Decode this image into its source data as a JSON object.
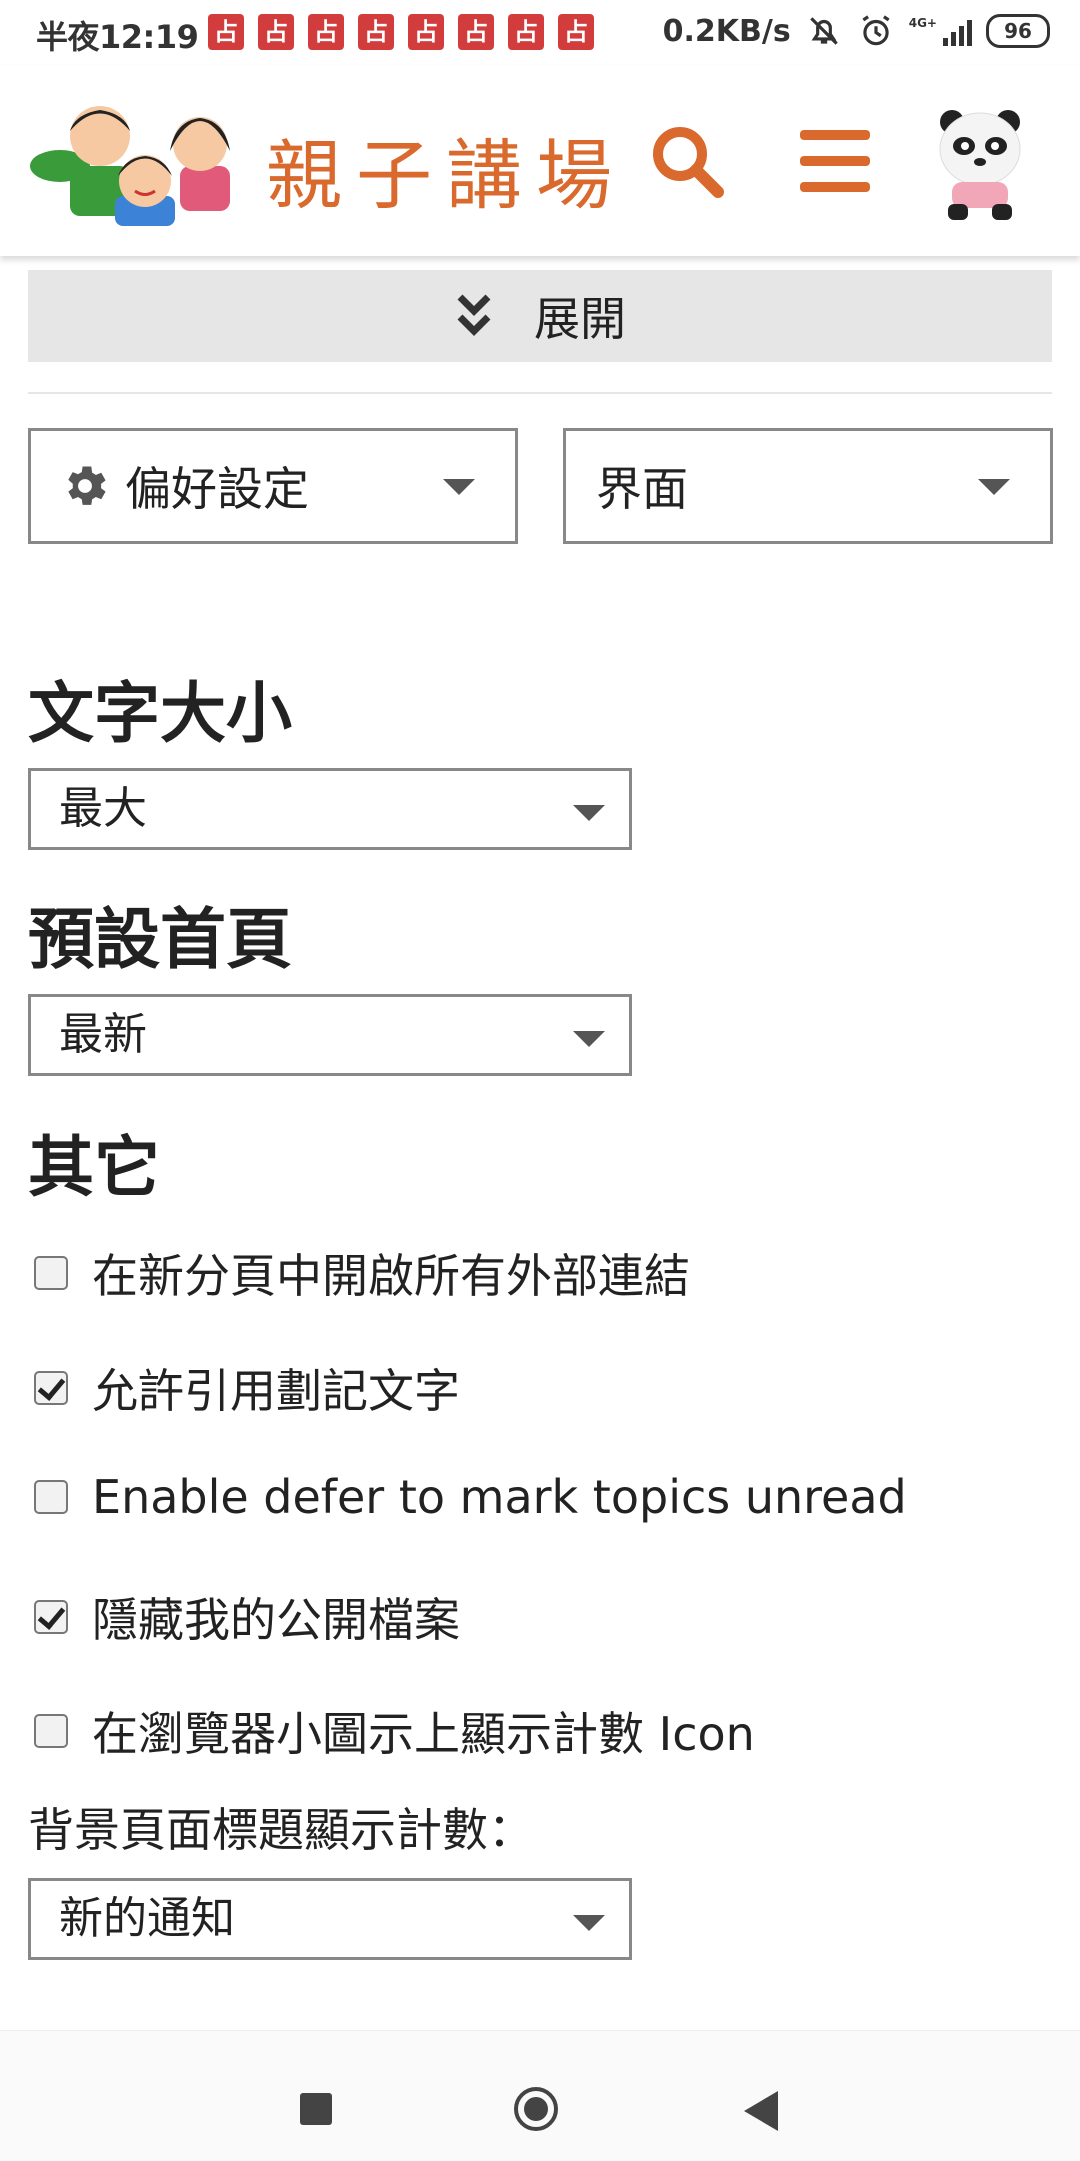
{
  "status_bar": {
    "time": "半夜12:19",
    "app_icons": [
      "占",
      "占",
      "占",
      "占",
      "占",
      "占",
      "占",
      "占"
    ],
    "network_speed": "0.2KB/s",
    "signal_label": "4G+",
    "battery": "96"
  },
  "header": {
    "site_title": "親子講場",
    "accent_color": "#d9692c"
  },
  "expand_bar": {
    "label": "展開"
  },
  "top_selects": {
    "preferences": "偏好設定",
    "interface": "界面"
  },
  "sections": {
    "text_size": {
      "title": "文字大小",
      "value": "最大"
    },
    "default_home": {
      "title": "預設首頁",
      "value": "最新"
    },
    "other": {
      "title": "其它",
      "options": [
        {
          "label": "在新分頁中開啟所有外部連結",
          "checked": false
        },
        {
          "label": "允許引用劃記文字",
          "checked": true
        },
        {
          "label": "Enable defer to mark topics unread",
          "checked": false
        },
        {
          "label": "隱藏我的公開檔案",
          "checked": true
        },
        {
          "label": "在瀏覽器小圖示上顯示計數 Icon",
          "checked": false
        }
      ]
    },
    "background_title": {
      "label": "背景頁面標題顯示計數：",
      "value": "新的通知"
    }
  }
}
